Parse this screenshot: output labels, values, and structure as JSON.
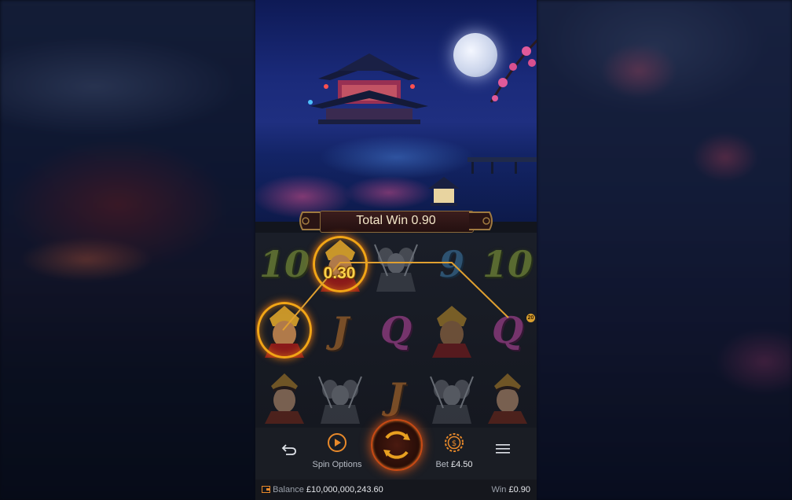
{
  "banner": {
    "total_win_label": "Total Win 0.90"
  },
  "reels": {
    "rows": [
      [
        "10",
        "general-red",
        "warriors",
        "9",
        "10"
      ],
      [
        "general-red",
        "J",
        "Q",
        "general-red",
        "Q"
      ],
      [
        "hero",
        "warriors",
        "J",
        "warriors",
        "hero"
      ]
    ],
    "win_amount": "0.30",
    "payline_badge": "20"
  },
  "controls": {
    "spin_options_label": "Spin Options",
    "bet_label": "Bet",
    "bet_value": "£4.50",
    "bet_icon_glyph": "$"
  },
  "status": {
    "balance_label": "Balance",
    "balance_value": "£10,000,000,243.60",
    "win_label": "Win",
    "win_value": "£0.90"
  },
  "icons": [
    "undo-icon",
    "play-circle-icon",
    "spin-icon",
    "coin-icon",
    "menu-icon",
    "wallet-icon"
  ],
  "colors": {
    "accent": "#f2a516",
    "spin_glow": "#d8561a",
    "payline": "#e0a030"
  }
}
